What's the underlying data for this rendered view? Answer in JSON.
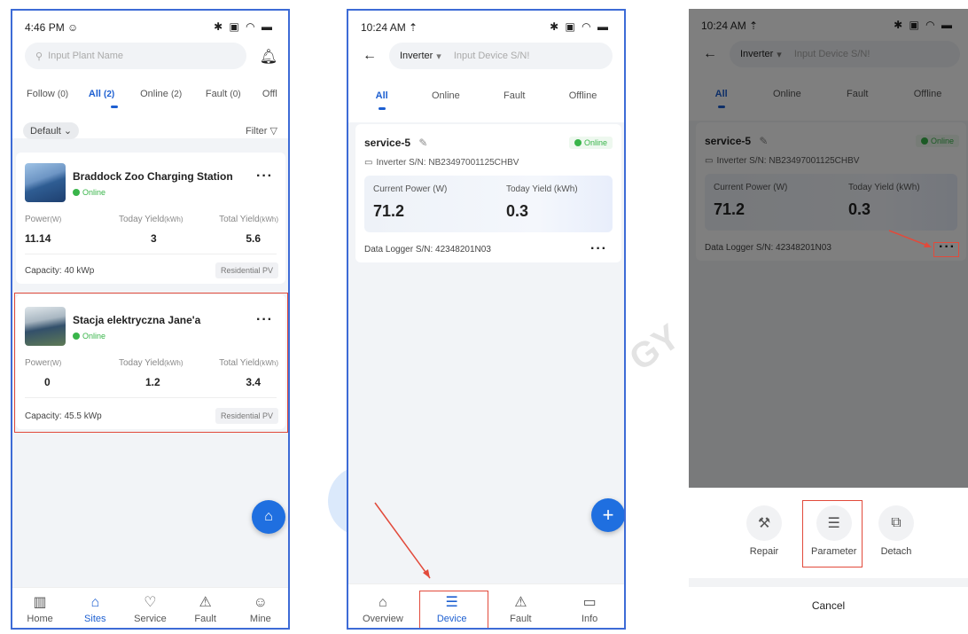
{
  "screen1": {
    "time": "4:46 PM",
    "time_icon": "☺",
    "status_icons": "✱ ▣ ◠ ▬",
    "search_placeholder": "Input Plant Name",
    "tabs": [
      {
        "label": "Follow",
        "count": "(0)"
      },
      {
        "label": "All",
        "count": "(2)"
      },
      {
        "label": "Online",
        "count": "(2)"
      },
      {
        "label": "Fault",
        "count": "(0)"
      },
      {
        "label": "Offl",
        "count": ""
      }
    ],
    "sort_label": "Default",
    "filter_label": "Filter",
    "plants": [
      {
        "name": "Braddock Zoo Charging Station",
        "status": "Online",
        "power_label": "Power",
        "power_unit": "(W)",
        "power": "11.14",
        "today_label": "Today Yield",
        "today_unit": "(kWh)",
        "today": "3",
        "total_label": "Total Yield",
        "total_unit": "(kWh)",
        "total": "5.6",
        "capacity": "Capacity: 40 kWp",
        "type": "Residential PV"
      },
      {
        "name": "Stacja elektryczna Jane'a",
        "status": "Online",
        "power_label": "Power",
        "power_unit": "(W)",
        "power": "0",
        "today_label": "Today Yield",
        "today_unit": "(kWh)",
        "today": "1.2",
        "total_label": "Total Yield",
        "total_unit": "(kWh)",
        "total": "3.4",
        "capacity": "Capacity: 45.5 kWp",
        "type": "Residential PV"
      }
    ],
    "nav": [
      {
        "label": "Home",
        "icon": "chart-icon",
        "glyph": "▥"
      },
      {
        "label": "Sites",
        "icon": "home-icon",
        "glyph": "⌂"
      },
      {
        "label": "Service",
        "icon": "heart-icon",
        "glyph": "♡"
      },
      {
        "label": "Fault",
        "icon": "warning-icon",
        "glyph": "⚠"
      },
      {
        "label": "Mine",
        "icon": "user-icon",
        "glyph": "☺"
      }
    ]
  },
  "screen2": {
    "time": "10:24 AM",
    "time_icon": "⇡",
    "status_icons": "✱ ▣ ◠ ▬",
    "device_type": "Inverter",
    "search_placeholder": "Input Device S/N!",
    "tabs": [
      "All",
      "Online",
      "Fault",
      "Offline"
    ],
    "device": {
      "name": "service-5",
      "status": "Online",
      "sn_label": "Inverter S/N: NB23497001125CHBV",
      "power_label": "Current Power (W)",
      "power": "71.2",
      "yield_label": "Today Yield (kWh)",
      "yield": "0.3",
      "logger": "Data Logger S/N: 42348201N03"
    },
    "nav": [
      {
        "label": "Overview",
        "glyph": "⌂"
      },
      {
        "label": "Device",
        "glyph": "☰"
      },
      {
        "label": "Fault",
        "glyph": "⚠"
      },
      {
        "label": "Info",
        "glyph": "▭"
      }
    ]
  },
  "screen3": {
    "actions": [
      {
        "label": "Repair",
        "glyph": "⚒"
      },
      {
        "label": "Parameter",
        "glyph": "☰"
      },
      {
        "label": "Detach",
        "glyph": "⧉"
      }
    ],
    "cancel": "Cancel"
  },
  "colors": {
    "accent": "#1d5fd1",
    "online": "#39b54a",
    "highlight": "#e24a3b",
    "frame": "#3d6bd6"
  }
}
